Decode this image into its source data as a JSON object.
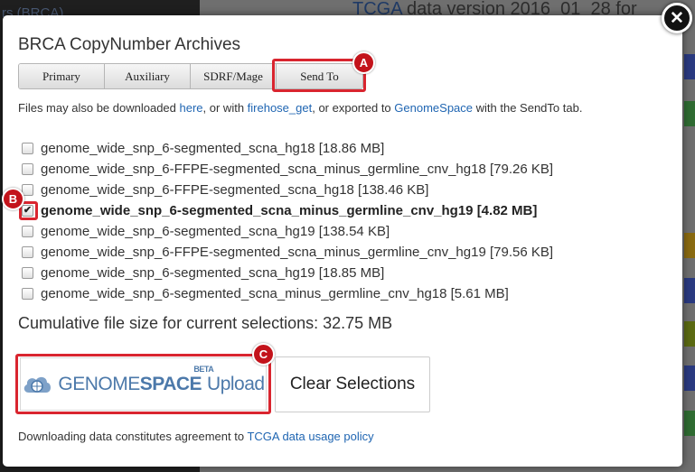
{
  "background": {
    "left_title": "rs (BRCA)",
    "header_link": "TCGA",
    "header_text": " data version 2016_01_28 for"
  },
  "modal": {
    "title": "BRCA CopyNumber Archives",
    "close_label": "✕",
    "tabs": [
      {
        "label": "Primary"
      },
      {
        "label": "Auxiliary"
      },
      {
        "label": "SDRF/Mage"
      },
      {
        "label": "Send To"
      }
    ],
    "info": {
      "prefix": "Files may also be downloaded ",
      "link_here": "here",
      "middle": ", or with ",
      "link_firehose": "firehose_get",
      "middle2": ", or exported to ",
      "link_genomespace": "GenomeSpace",
      "suffix": " with the SendTo tab."
    },
    "files": [
      {
        "name": "genome_wide_snp_6-segmented_scna_hg18 [18.86 MB]",
        "checked": false
      },
      {
        "name": "genome_wide_snp_6-FFPE-segmented_scna_minus_germline_cnv_hg18 [79.26 KB]",
        "checked": false
      },
      {
        "name": "genome_wide_snp_6-FFPE-segmented_scna_hg18 [138.46 KB]",
        "checked": false
      },
      {
        "name": "genome_wide_snp_6-segmented_scna_minus_germline_cnv_hg19 [4.82 MB]",
        "checked": true
      },
      {
        "name": "genome_wide_snp_6-segmented_scna_hg19 [138.54 KB]",
        "checked": false
      },
      {
        "name": "genome_wide_snp_6-FFPE-segmented_scna_minus_germline_cnv_hg19 [79.56 KB]",
        "checked": false
      },
      {
        "name": "genome_wide_snp_6-segmented_scna_hg19 [18.85 MB]",
        "checked": false
      },
      {
        "name": "genome_wide_snp_6-segmented_scna_minus_germline_cnv_hg18 [5.61 MB]",
        "checked": false
      }
    ],
    "cumulative": "Cumulative file size for current selections: 32.75 MB",
    "genomespace_button": {
      "prefix": "GENOME",
      "bold": "SPACE",
      "suffix": "Upload",
      "beta": "BETA",
      "icon": "cloud-network-icon"
    },
    "clear_button": "Clear Selections",
    "footer": {
      "prefix": "Downloading data constitutes agreement to ",
      "link": "TCGA data usage policy"
    }
  },
  "annotations": {
    "a": "A",
    "b": "B",
    "c": "C"
  },
  "colors": {
    "annotation_red": "#d9252f",
    "link_blue": "#1f65b2",
    "genomespace_blue": "#4c79aa"
  }
}
